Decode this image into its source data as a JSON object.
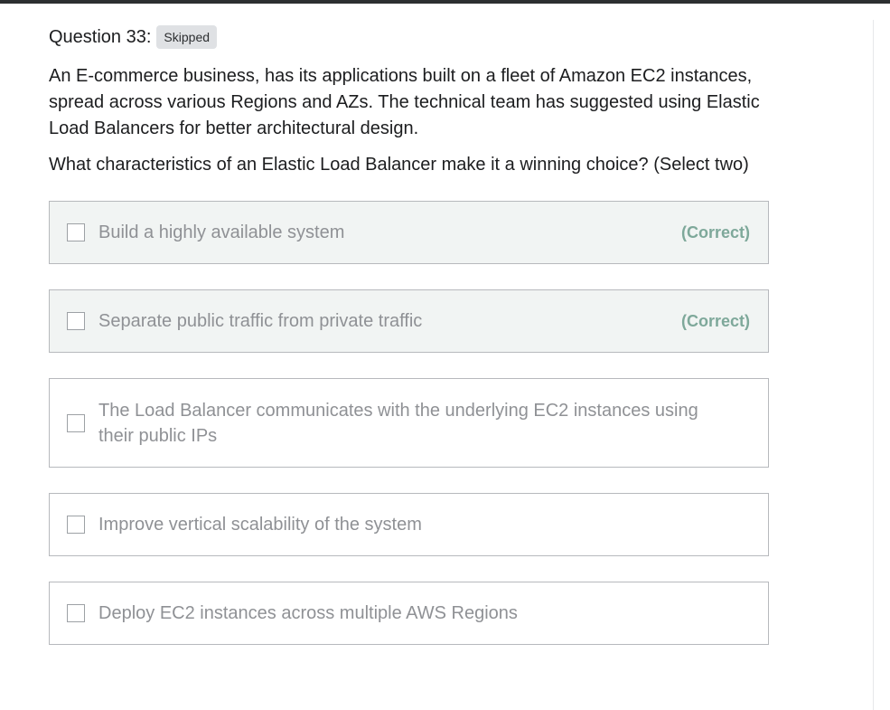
{
  "question": {
    "title": "Question 33:",
    "status": "Skipped",
    "paragraphs": [
      "An E-commerce business, has its applications built on a fleet of Amazon EC2 instances, spread across various Regions and AZs. The technical team has suggested using Elastic Load Balancers for better architectural design.",
      "What characteristics of an Elastic Load Balancer make it a winning choice? (Select two)"
    ]
  },
  "answers": [
    {
      "text": "Build a highly available system",
      "tag": "(Correct)"
    },
    {
      "text": "Separate public traffic from private traffic",
      "tag": "(Correct)"
    },
    {
      "text": "The Load Balancer communicates with the underlying EC2 instances using their public IPs"
    },
    {
      "text": "Improve vertical scalability of the system"
    },
    {
      "text": "Deploy EC2 instances across multiple AWS Regions"
    }
  ],
  "colors": {
    "correct_tag": "#7ea89a",
    "correct_bg": "#f1f4f3",
    "badge_bg": "#dfe1e4"
  }
}
